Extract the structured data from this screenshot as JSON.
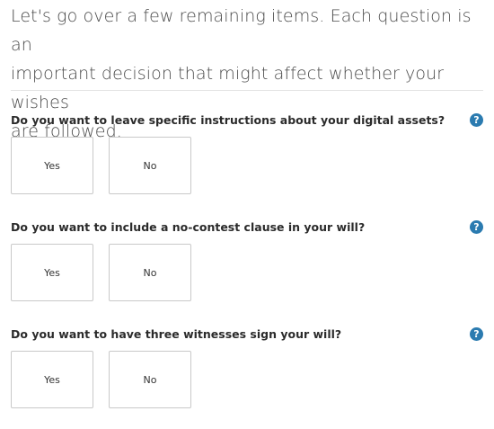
{
  "intro": {
    "line1": "Let's go over a few remaining items. Each question is an",
    "line2": "important decision that might affect whether your wishes",
    "line3": "are followed."
  },
  "questions": [
    {
      "text": "Do you want to leave specific instructions about your digital assets?",
      "yes_label": "Yes",
      "no_label": "No",
      "help_icon": "?"
    },
    {
      "text": "Do you want to include a no-contest clause in your will?",
      "yes_label": "Yes",
      "no_label": "No",
      "help_icon": "?"
    },
    {
      "text": "Do you want to have three witnesses sign your will?",
      "yes_label": "Yes",
      "no_label": "No",
      "help_icon": "?"
    }
  ],
  "colors": {
    "accent": "#2b7bb0",
    "text": "#2b2b2b",
    "border": "#c9c9c9"
  }
}
